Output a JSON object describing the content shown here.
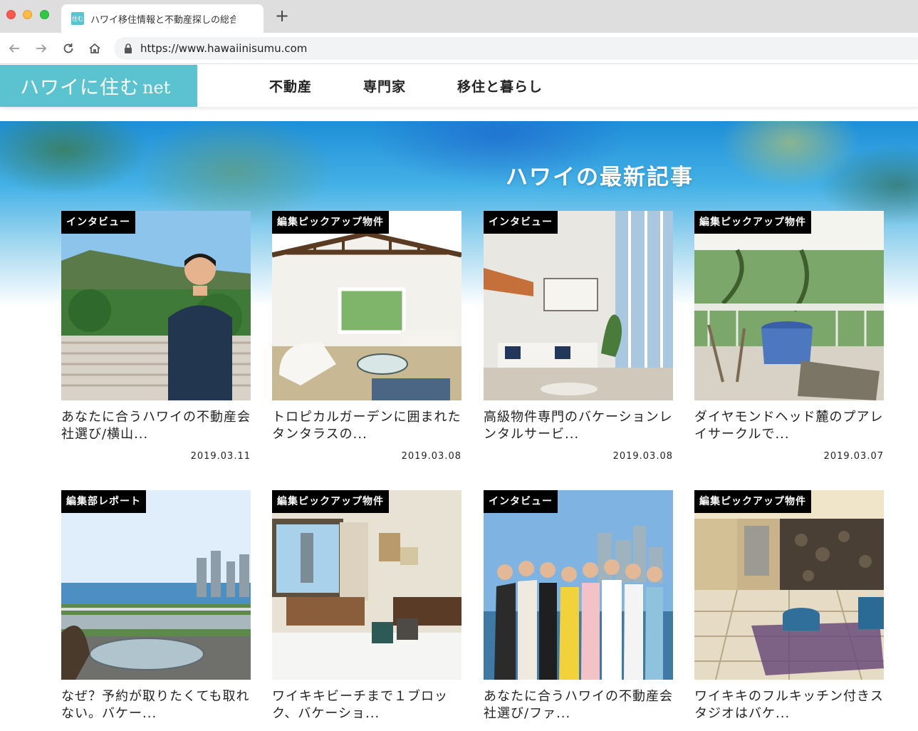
{
  "browser": {
    "tab_title": "ハワイ移住情報と不動産探しの総合サイト",
    "favicon_text": "住む",
    "url": "https://www.hawaiinisumu.com"
  },
  "header": {
    "logo_main": "ハワイに住む",
    "logo_suffix": "net",
    "nav": [
      "不動産",
      "専門家",
      "移住と暮らし"
    ]
  },
  "main": {
    "section_title": "ハワイの最新記事",
    "articles": [
      {
        "category": "インタビュー",
        "title": "あなたに合うハワイの不動産会社選び/横山...",
        "date": "2019.03.11",
        "image": "man-diamond-head"
      },
      {
        "category": "編集ピックアップ物件",
        "title": "トロピカルガーデンに囲まれたタンタラスの...",
        "date": "2019.03.08",
        "image": "living-room-beams"
      },
      {
        "category": "インタビュー",
        "title": "高級物件専門のバケーションレンタルサービ...",
        "date": "2019.03.08",
        "image": "luxury-loft-living"
      },
      {
        "category": "編集ピックアップ物件",
        "title": "ダイヤモンドヘッド麓のプアレイサークルで...",
        "date": "2019.03.07",
        "image": "lanai-dining"
      },
      {
        "category": "編集部レポート",
        "title": "なぜ？予約が取りたくても取れない。バケー...",
        "date": "",
        "image": "ocean-view-lanai"
      },
      {
        "category": "編集ピックアップ物件",
        "title": "ワイキキビーチまで１ブロック、バケーショ...",
        "date": "",
        "image": "bedroom-view"
      },
      {
        "category": "インタビュー",
        "title": "あなたに合うハワイの不動産会社選び/ファ...",
        "date": "",
        "image": "group-photo"
      },
      {
        "category": "編集ピックアップ物件",
        "title": "ワイキキのフルキッチン付きスタジオはバケ...",
        "date": "",
        "image": "lobby-interior"
      }
    ]
  },
  "colors": {
    "brand": "#5bc3cf",
    "badge_bg": "#000000"
  }
}
